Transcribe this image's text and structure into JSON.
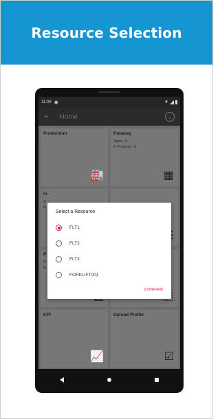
{
  "banner": {
    "title": "Resource Selection",
    "color": "#1596d2"
  },
  "phone": {
    "status_bar": {
      "time": "11:09"
    },
    "app_bar": {
      "title": "Home"
    },
    "tiles": [
      {
        "title": "Production",
        "lines": [],
        "icon": "factory-icon"
      },
      {
        "title": "Putaway",
        "lines": [
          "Open - 0",
          "In Progress - 0"
        ],
        "icon": "shelves-icon"
      },
      {
        "title": "In",
        "lines": [
          "O",
          "In"
        ],
        "icon": ""
      },
      {
        "title": "",
        "lines": [],
        "icon": ""
      },
      {
        "title": "P",
        "lines": [
          "O",
          "In"
        ],
        "icon": "calendar-icon"
      },
      {
        "title": "",
        "lines": [],
        "icon": "box-icon"
      },
      {
        "title": "KPI",
        "lines": [],
        "icon": "chart-icon"
      },
      {
        "title": "Upload Profile",
        "lines": [],
        "icon": "checkbox-icon"
      }
    ],
    "dialog": {
      "title": "Select a Resource",
      "options": [
        {
          "label": "FLT1",
          "selected": true
        },
        {
          "label": "FLT2",
          "selected": false
        },
        {
          "label": "FLT3",
          "selected": false
        },
        {
          "label": "FORKLIFT001",
          "selected": false
        }
      ],
      "confirm_label": "CONFIRM",
      "accent_color": "#e0105a"
    }
  }
}
